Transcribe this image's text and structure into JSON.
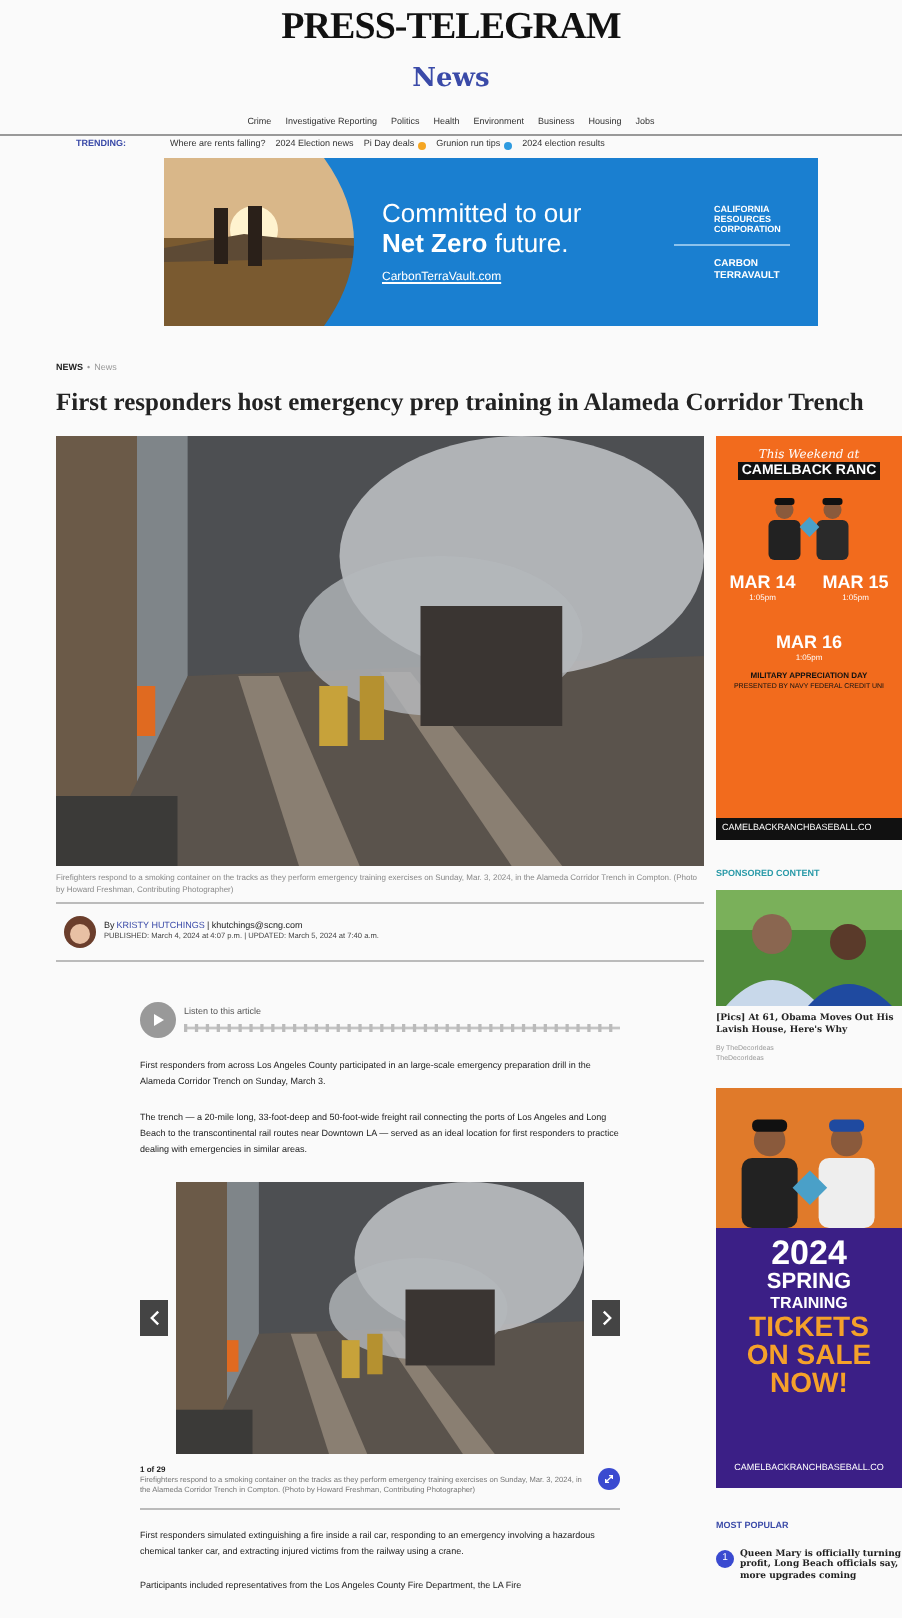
{
  "masthead": {
    "logo": "PRESS-TELEGRAM",
    "section": "News"
  },
  "nav": [
    "Crime",
    "Investigative Reporting",
    "Politics",
    "Health",
    "Environment",
    "Business",
    "Housing",
    "Jobs"
  ],
  "trending": {
    "label": "TRENDING:",
    "items": [
      {
        "text": "Where are rents falling?"
      },
      {
        "text": "2024 Election news"
      },
      {
        "text": "Pi Day deals",
        "color": "#f5a623"
      },
      {
        "text": "Grunion run tips",
        "color": "#2f9be0"
      },
      {
        "text": "2024 election results"
      }
    ]
  },
  "ad_banner": {
    "line_1": "Committed to our",
    "line_2": "Net Zero future.",
    "url": "CarbonTerraVault.com",
    "sponsor_1": "CALIFORNIA RESOURCES CORPORATION",
    "sponsor_2": "CARBON TERRAVAULT"
  },
  "breadcrumb": {
    "section": "NEWS",
    "separator": "•",
    "sub": "News"
  },
  "headline": "First responders host emergency prep training in Alameda Corridor Trench",
  "hero": {
    "caption": "Firefighters respond to a smoking container on the tracks as they perform emergency training exercises on Sunday, Mar. 3, 2024, in the Alameda Corridor Trench in Compton. (Photo by Howard Freshman, Contributing Photographer)"
  },
  "byline": {
    "prefix": "By",
    "author": "KRISTY HUTCHINGS",
    "email": "| khutchings@scng.com",
    "dates": "PUBLISHED: March 4, 2024 at 4:07 p.m. | UPDATED: March 5, 2024 at 7:40 a.m."
  },
  "audio": {
    "label": "Listen to this article"
  },
  "paragraphs_top": [
    "First responders from across Los Angeles County participated in an large-scale emergency preparation drill in the Alameda Corridor Trench on Sunday, March 3.",
    "The trench — a 20-mile long, 33-foot-deep and 50-foot-wide freight rail connecting the ports of Los Angeles and Long Beach to the transcontinental rail routes near Downtown LA — served as an ideal location for first responders to practice dealing with emergencies in similar areas."
  ],
  "gallery": {
    "counter": "1 of 29",
    "caption": "Firefighters respond to a smoking container on the tracks as they perform emergency training exercises on Sunday, Mar. 3, 2024, in the Alameda Corridor Trench in Compton. (Photo by Howard Freshman, Contributing Photographer)"
  },
  "paragraphs_bottom": [
    "First responders simulated extinguishing a fire inside a rail car, responding to an emergency involving a hazardous chemical tanker car, and extracting injured victims from the railway using a crane.",
    "Participants included representatives from the Los Angeles County Fire Department, the LA Fire"
  ],
  "sidebar": {
    "ad_top": {
      "kicker": "This Weekend at",
      "title": "CAMELBACK RANC",
      "games": [
        {
          "date": "MAR 14",
          "time": "1:05pm"
        },
        {
          "date": "MAR 15",
          "time": "1:05pm"
        },
        {
          "date": "MAR 16",
          "time": "1:05pm"
        }
      ],
      "event": "MILITARY APPRECIATION DAY",
      "presenter": "PRESENTED BY NAVY FEDERAL CREDIT UNI",
      "url": "CAMELBACKRANCHBASEBALL.CO"
    },
    "sponsored": {
      "heading": "SPONSORED CONTENT",
      "title": "[Pics] At 61, Obama Moves Out His Lavish House, Here's Why",
      "by": "By TheDecorIdeas",
      "source": "TheDecorIdeas"
    },
    "ad_bottom": {
      "year": "2024",
      "line_1": "SPRING",
      "line_2": "TRAINING",
      "line_3": "TICKETS",
      "line_4": "ON SALE",
      "line_5": "NOW!",
      "url": "CAMELBACKRANCHBASEBALL.CO"
    },
    "most_popular": {
      "heading": "MOST POPULAR",
      "items": [
        {
          "rank": "1",
          "title": "Queen Mary is officially turning profit, Long Beach officials say, more upgrades coming"
        }
      ]
    }
  }
}
